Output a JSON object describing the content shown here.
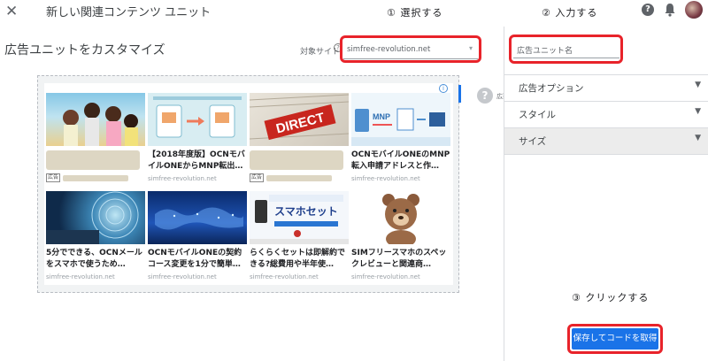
{
  "topbar": {
    "close_icon": "✕",
    "title": "新しい関連コンテンツ ユニット",
    "help_icon": "?"
  },
  "annotations": {
    "step1": "① 選択する",
    "step2": "② 入力する",
    "step3": "③ クリックする"
  },
  "header": {
    "title": "広告ユニットをカスタマイズ",
    "site_label": "対象サイト",
    "site_help": "?",
    "site_value": "simfree-revolution.net",
    "site_caret": "▾"
  },
  "right_panel": {
    "name_placeholder": "広告ユニット名",
    "rows": [
      {
        "label": "広告オプション",
        "chevron": "⌄"
      },
      {
        "label": "スタイル",
        "chevron": "⌄"
      },
      {
        "label": "サイズ",
        "chevron": "⌄"
      }
    ],
    "save_button": "保存してコードを取得"
  },
  "preview": {
    "adchoice": "i",
    "side_help": "?",
    "side_text": "広要のよ確",
    "tiles": [
      {
        "type": "ad",
        "thumb": "people",
        "ad_label": "広告"
      },
      {
        "type": "content",
        "thumb": "sim",
        "caption": "【2018年度版】OCNモバイルONEからMNP転出…",
        "source": "simfree-revolution.net"
      },
      {
        "type": "ad",
        "thumb": "direct",
        "ad_label": "広告"
      },
      {
        "type": "content",
        "thumb": "mnp",
        "caption": "OCNモバイルONEのMNP転入申請アドレスと作…",
        "source": "simfree-revolution.net"
      },
      {
        "type": "content",
        "thumb": "tech",
        "caption": "5分でできる、OCNメールをスマホで使うため…",
        "source": "simfree-revolution.net"
      },
      {
        "type": "content",
        "thumb": "map",
        "caption": "OCNモバイルONEの契約コース変更を1分で簡単…",
        "source": "simfree-revolution.net"
      },
      {
        "type": "content",
        "thumb": "phone",
        "caption": "らくらくセットは即解約できる?総費用や半年使…",
        "source": "simfree-revolution.net",
        "thumb_text": "スマホセット"
      },
      {
        "type": "content",
        "thumb": "bear",
        "caption": "SIMフリースマホのスペックレビューと関連商…",
        "source": "simfree-revolution.net"
      }
    ],
    "direct_text": "DIRECT",
    "mnp_text": "MNP"
  }
}
